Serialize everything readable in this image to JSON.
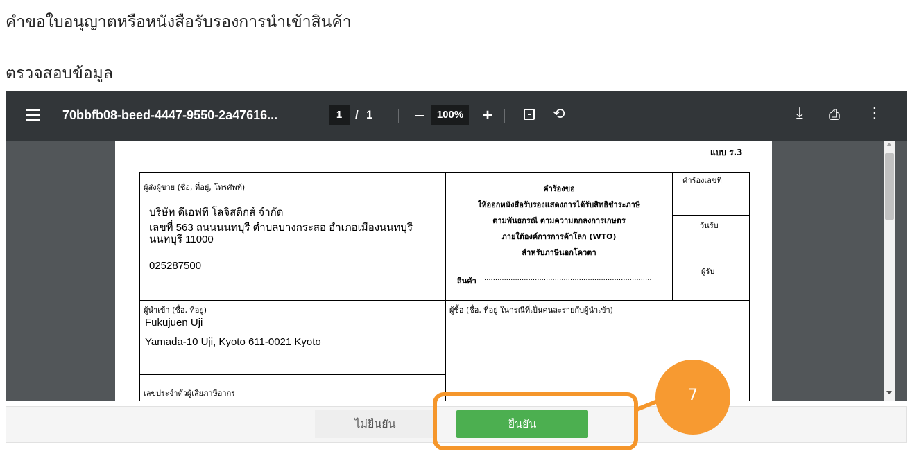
{
  "header": {
    "title": "คำขอใบอนุญาตหรือหนังสือรับรองการนำเข้าสินค้า",
    "section_title": "ตรวจสอบข้อมูล"
  },
  "pdf_viewer": {
    "filename": "70bbfb08-beed-4447-9550-2a47616...",
    "current_page": "1",
    "page_separator": "/",
    "total_pages": "1",
    "zoom": "100%",
    "zoom_in_symbol": "+",
    "icons": [
      "menu-icon",
      "zoom-out-icon",
      "zoom-in-icon",
      "fit-page-icon",
      "rotate-icon",
      "download-icon",
      "print-icon",
      "more-icon"
    ]
  },
  "document": {
    "form_code": "แบบ ร.3",
    "sender_label": "ผู้ส่งผู้ขาย (ชื่อ, ที่อยู่, โทรศัพท์)",
    "sender_name": "บริษัท ดีเอฟที โลจิสติกส์ จำกัด",
    "sender_address_1": "เลขที่ 563 ถนนนนทบุรี ตำบลบางกระสอ อำเภอเมืองนนทบุรี",
    "sender_address_2": "นนทบุรี 11000",
    "sender_phone": "025287500",
    "request_title": "คำร้องขอ",
    "request_line_1": "ให้ออกหนังสือรับรองแสดงการได้รับสิทธิชำระภาษี",
    "request_line_2": "ตามพันธกรณี ตามความตกลงการเกษตร",
    "request_line_3": "ภายใต้องค์การการค้าโลก (WTO)",
    "request_line_4": "สำหรับภาษีนอกโควตา",
    "goods_label": "สินค้า",
    "goods_dots": "............................................................................",
    "request_no_label": "คำร้องเลขที่",
    "received_date_label": "วันรับ",
    "receiver_label": "ผู้รับ",
    "importer_label": "ผู้นำเข้า (ชื่อ, ที่อยู่)",
    "importer_name": "Fukujuen Uji",
    "importer_address": "Yamada-10 Uji, Kyoto 611-0021    Kyoto",
    "buyer_label": "ผู้ซื้อ (ชื่อ, ที่อยู่ ในกรณีที่เป็นคนละรายกับผู้นำเข้า)",
    "tax_id_label": "เลขประจำตัวผู้เสียภาษีอากร"
  },
  "actions": {
    "cancel_label": "ไม่ยืนยัน",
    "confirm_label": "ยืนยัน"
  },
  "annotation": {
    "step_number": "7",
    "color": "#f5962b"
  },
  "colors": {
    "toolbar": "#323639",
    "viewer_bg": "#525659",
    "confirm": "#4caf50"
  }
}
